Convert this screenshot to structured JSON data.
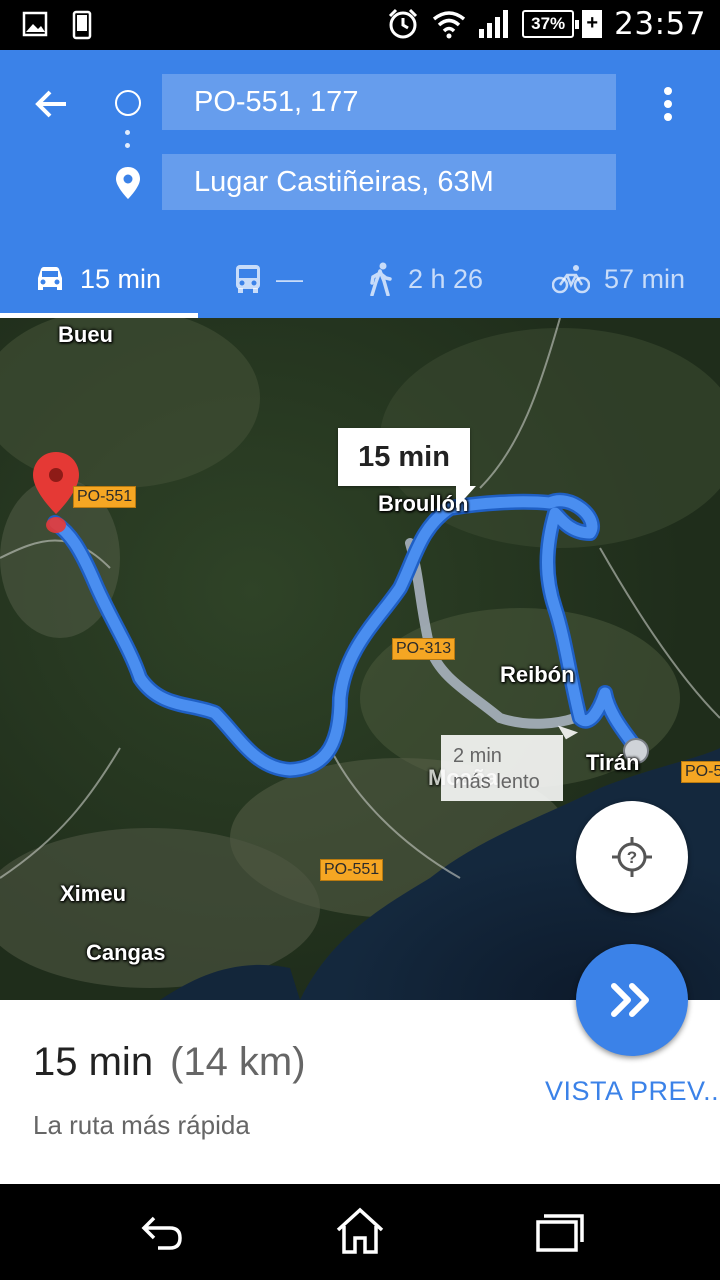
{
  "status_bar": {
    "battery": "37%",
    "time": "23:57",
    "icons": [
      "image-icon",
      "phone-icon",
      "alarm-icon",
      "wifi-icon",
      "signal-icon",
      "battery-icon",
      "charging-icon"
    ]
  },
  "header": {
    "origin": "PO-551, 177",
    "destination": "Lugar Castiñeiras, 63M",
    "icons": [
      "back-arrow-icon",
      "more-vert-icon",
      "origin-circle-icon",
      "destination-pin-icon"
    ]
  },
  "modes": [
    {
      "name": "car",
      "icon": "car-icon",
      "label": "15 min",
      "active": true
    },
    {
      "name": "transit",
      "icon": "bus-icon",
      "label": "—",
      "active": false
    },
    {
      "name": "walk",
      "icon": "walk-icon",
      "label": "2 h 26",
      "active": false
    },
    {
      "name": "bike",
      "icon": "bike-icon",
      "label": "57 min",
      "active": false
    }
  ],
  "map": {
    "places": [
      "Bueu",
      "Broullón",
      "Reibón",
      "Tirán",
      "Ximeu",
      "Cangas",
      "Moaña"
    ],
    "roads": [
      "PO-551",
      "PO-313",
      "PO-551",
      "PO-5"
    ],
    "route_callout": "15 min",
    "alt_route_line1": "2 min",
    "alt_route_line2": "más lento",
    "colors": {
      "route": "#4a8ef0",
      "alt_route": "#a9b3bf",
      "accent": "#3b82e8",
      "pin": "#e53935"
    }
  },
  "sheet": {
    "time": "15 min",
    "distance": "(14 km)",
    "description": "La ruta más rápida",
    "preview_label": "VISTA PREV..."
  },
  "nav_bar": {
    "icons": [
      "back-nav-icon",
      "home-nav-icon",
      "recents-nav-icon"
    ]
  }
}
